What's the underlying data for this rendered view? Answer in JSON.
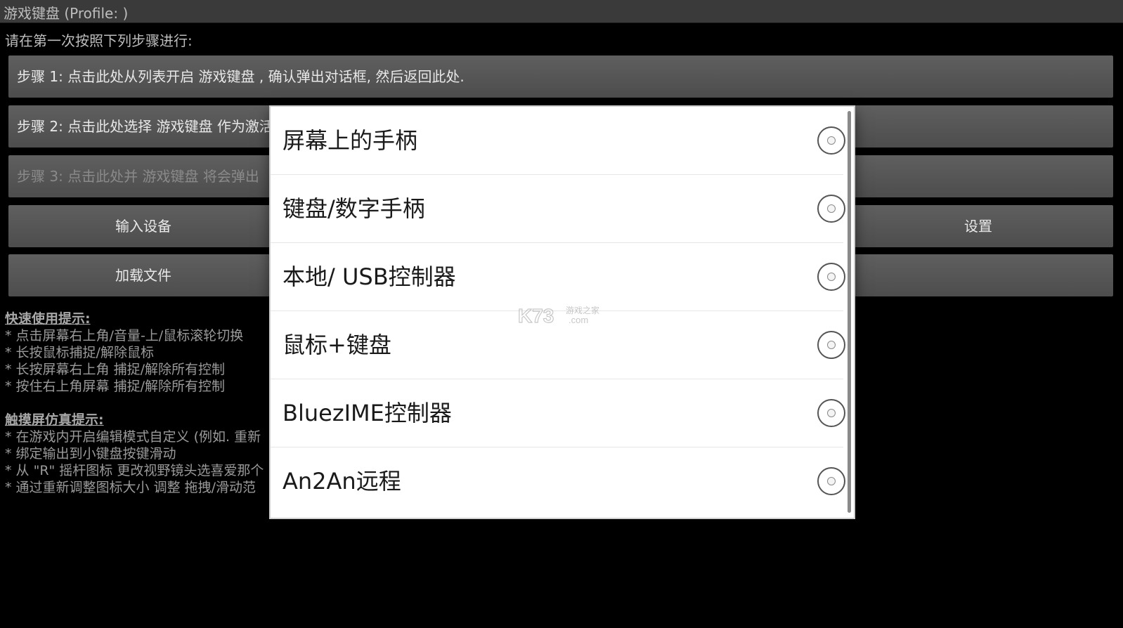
{
  "titlebar": {
    "title": "游戏键盘 (Profile: )"
  },
  "instructions": "请在第一次按照下列步骤进行:",
  "steps": [
    {
      "label": "步骤 1: 点击此处从列表开启 游戏键盘 , 确认弹出对话框, 然后返回此处."
    },
    {
      "label": "步骤 2: 点击此处选择 游戏键盘 作为激活"
    },
    {
      "label": "步骤 3: 点击此处并 游戏键盘 将会弹出"
    }
  ],
  "buttons": {
    "input_devices": "输入设备",
    "settings": "设置",
    "load_file": "加载文件"
  },
  "quick_tips": {
    "heading": "快速使用提示:",
    "items": [
      "* 点击屏幕右上角/音量-上/鼠标滚轮切换",
      "* 长按鼠标捕捉/解除鼠标",
      "* 长按屏幕右上角 捕捉/解除所有控制",
      "* 按住右上角屏幕 捕捉/解除所有控制"
    ]
  },
  "touch_tips": {
    "heading": "触摸屏仿真提示:",
    "items": [
      "* 在游戏内开启编辑模式自定义 (例如. 重新",
      "* 绑定输出到小键盘按键滑动",
      "* 从 \"R\" 摇杆图标 更改视野镜头选喜爱那个",
      "* 通过重新调整图标大小 调整 拖拽/滑动范"
    ]
  },
  "dialog": {
    "options": [
      {
        "label": "屏幕上的手柄",
        "selected": false
      },
      {
        "label": "键盘/数字手柄",
        "selected": false
      },
      {
        "label": "本地/ USB控制器",
        "selected": false
      },
      {
        "label": "鼠标+键盘",
        "selected": false
      },
      {
        "label": "BluezIME控制器",
        "selected": false
      },
      {
        "label": "An2An远程",
        "selected": false
      }
    ]
  },
  "watermark": {
    "main": "K73",
    "sub": "游戏之家",
    "domain": ".com"
  }
}
